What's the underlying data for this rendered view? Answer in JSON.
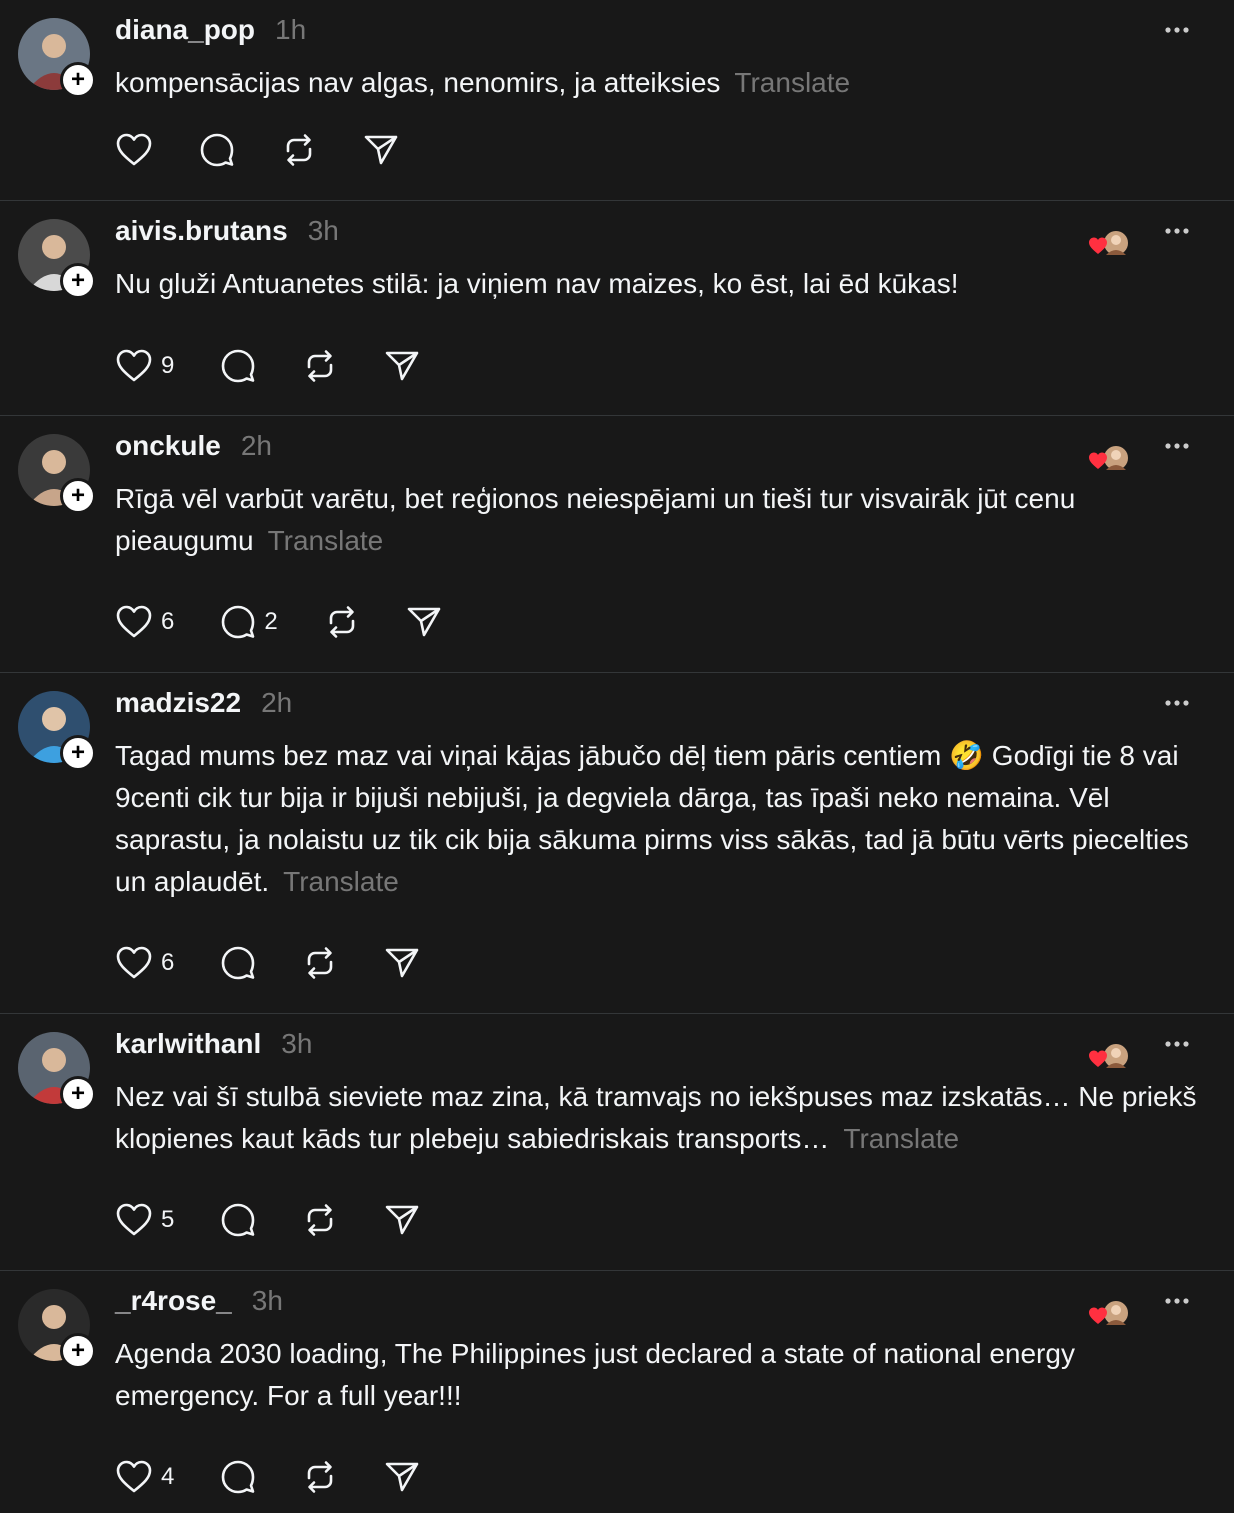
{
  "ui": {
    "colors": {
      "background": "#181818",
      "text": "#f3f5f7",
      "muted": "#777777",
      "divider": "#333638",
      "heart": "#ff3040"
    },
    "translate_label": "Translate"
  },
  "posts": [
    {
      "username": "diana_pop",
      "time": "1h",
      "text": "kompensācijas nav algas, nenomirs, ja atteiksies",
      "show_translate": true,
      "likes": "",
      "replies": "",
      "liked_by_avatar": false
    },
    {
      "username": "aivis.brutans",
      "time": "3h",
      "text": "Nu gluži Antuanetes stilā: ja viņiem nav maizes, ko ēst, lai ēd kūkas!",
      "show_translate": false,
      "likes": "9",
      "replies": "",
      "liked_by_avatar": true
    },
    {
      "username": "onckule",
      "time": "2h",
      "text": "Rīgā vēl varbūt varētu, bet reģionos neiespējami un tieši tur visvairāk jūt cenu pieaugumu",
      "show_translate": true,
      "likes": "6",
      "replies": "2",
      "liked_by_avatar": true
    },
    {
      "username": "madzis22",
      "time": "2h",
      "text": "Tagad mums bez maz vai viņai kājas jābučo dēļ tiem pāris centiem 🤣 Godīgi tie 8 vai 9centi cik tur bija ir bijuši nebijuši, ja degviela dārga, tas īpaši neko nemaina. Vēl saprastu, ja nolaistu uz tik cik bija sākuma pirms viss sākās, tad jā būtu vērts piecelties un aplaudēt.",
      "show_translate": true,
      "likes": "6",
      "replies": "",
      "liked_by_avatar": false
    },
    {
      "username": "karlwithanl",
      "time": "3h",
      "text": "Nez vai šī stulbā sieviete maz zina, kā tramvajs no iekšpuses maz izskatās… Ne priekš klopienes kaut kāds tur plebeju sabiedriskais transports…",
      "show_translate": true,
      "likes": "5",
      "replies": "",
      "liked_by_avatar": true
    },
    {
      "username": "_r4rose_",
      "time": "3h",
      "text": "Agenda 2030 loading, The Philippines just declared a state of national energy emergency. For a full year!!!",
      "show_translate": false,
      "likes": "4",
      "replies": "",
      "liked_by_avatar": true
    }
  ]
}
